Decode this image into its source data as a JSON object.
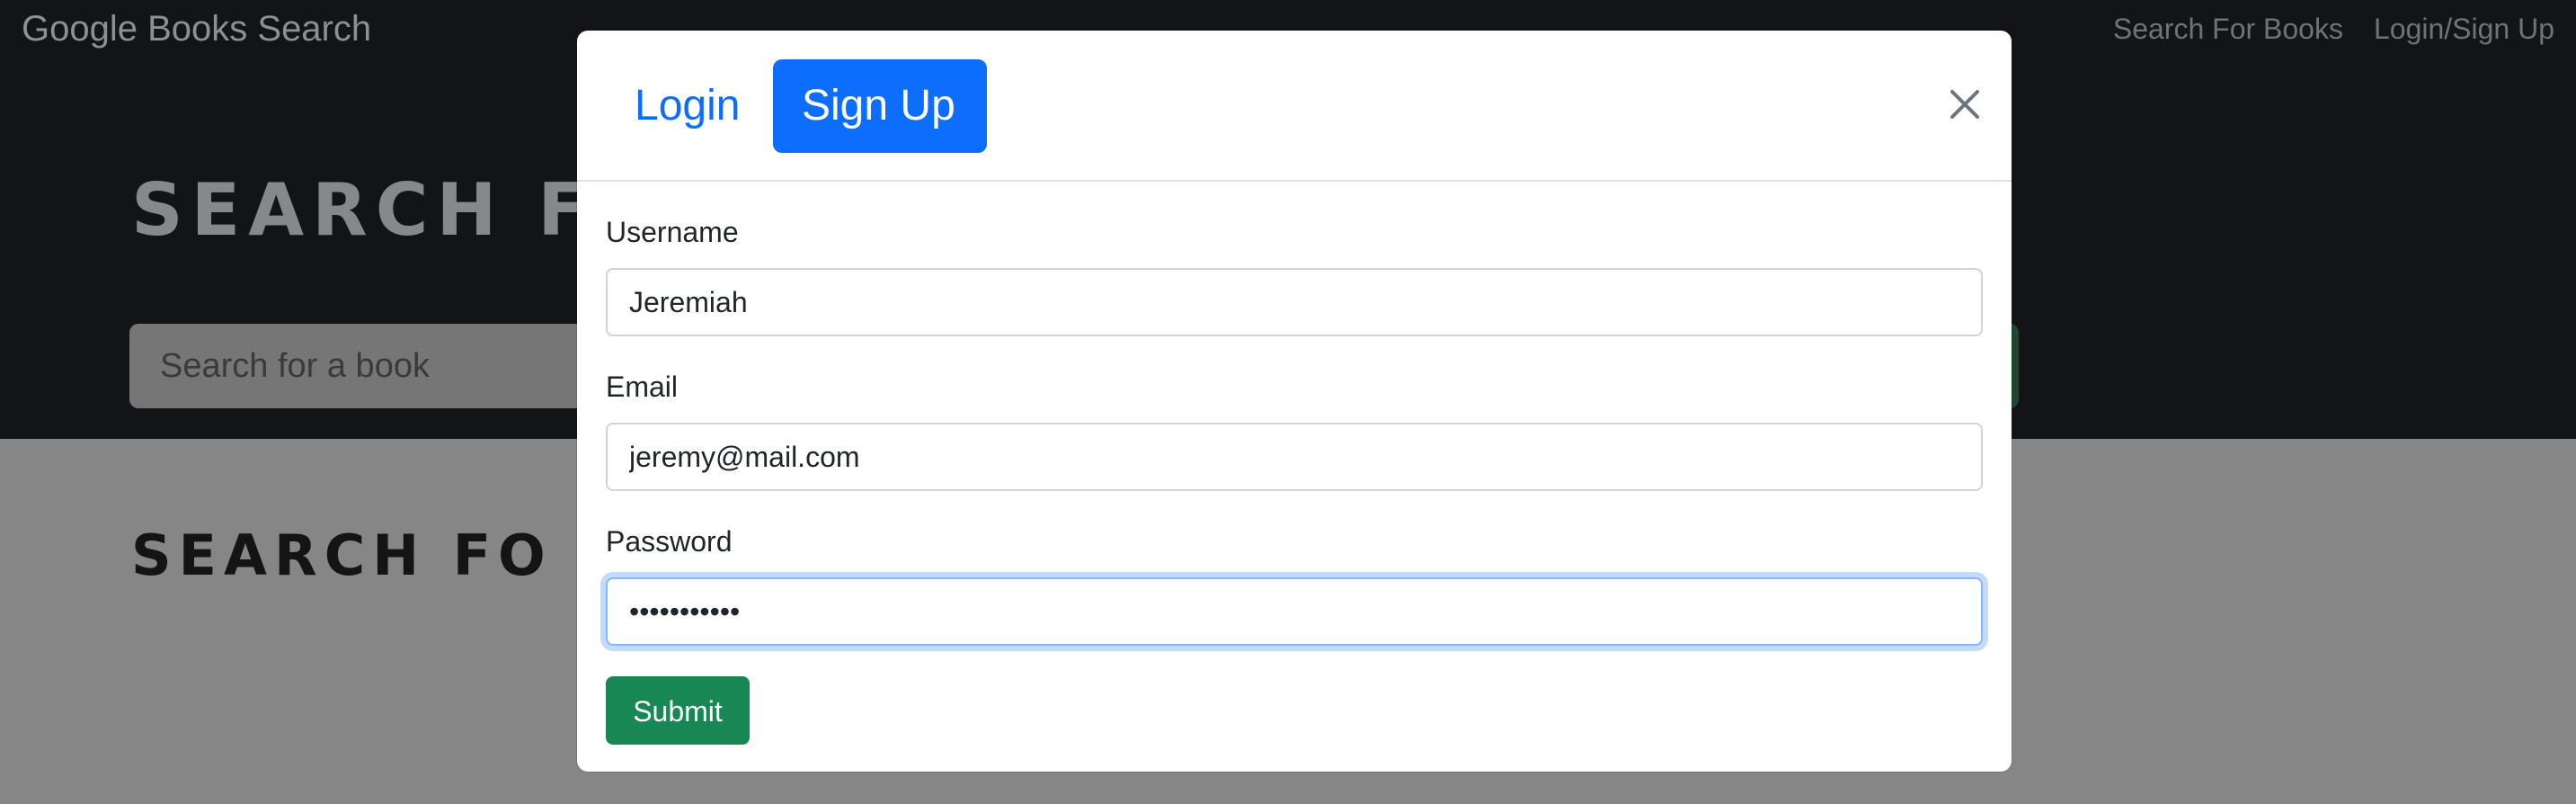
{
  "navbar": {
    "brand": "Google Books Search",
    "links": [
      "Search For Books",
      "Login/Sign Up"
    ]
  },
  "hero": {
    "title": "SEARCH F",
    "search_placeholder": "Search for a book"
  },
  "results": {
    "title": "SEARCH   FO"
  },
  "modal": {
    "tabs": [
      {
        "label": "Login",
        "active": false
      },
      {
        "label": "Sign Up",
        "active": true
      }
    ],
    "fields": {
      "username": {
        "label": "Username",
        "value": "Jeremiah"
      },
      "email": {
        "label": "Email",
        "value": "jeremy@mail.com"
      },
      "password": {
        "label": "Password",
        "value": "•••••••••••"
      }
    },
    "submit_label": "Submit"
  },
  "colors": {
    "primary": "#0d6efd",
    "success": "#198754",
    "navbar_bg": "#131417",
    "backdrop": "#868686"
  }
}
